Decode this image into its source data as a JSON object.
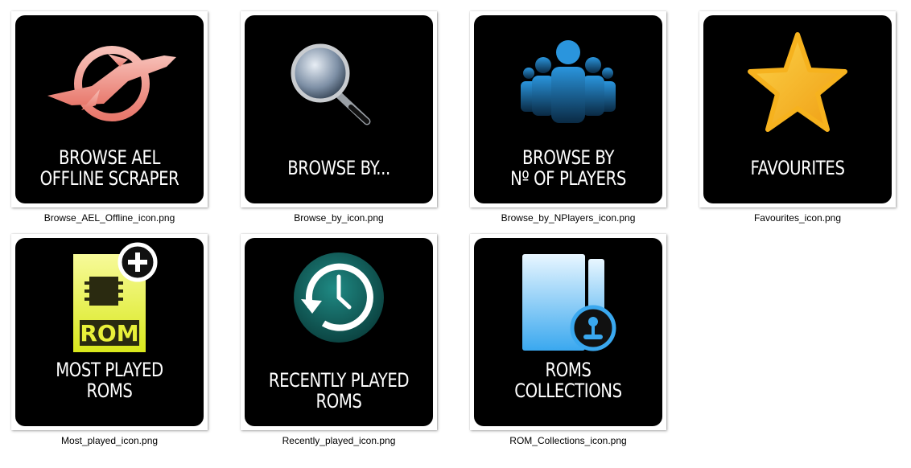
{
  "items": [
    {
      "label": "BROWSE AEL\nOFFLINE SCRAPER",
      "filename": "Browse_AEL_Offline_icon.png",
      "icon": "rocket-icon"
    },
    {
      "label": "BROWSE BY...",
      "filename": "Browse_by_icon.png",
      "icon": "magnifier-icon"
    },
    {
      "label": "BROWSE BY\nNº OF PLAYERS",
      "filename": "Browse_by_NPlayers_icon.png",
      "icon": "players-icon"
    },
    {
      "label": "FAVOURITES",
      "filename": "Favourites_icon.png",
      "icon": "star-icon"
    },
    {
      "label": "MOST PLAYED ROMS",
      "filename": "Most_played_icon.png",
      "icon": "rom-file-add-icon"
    },
    {
      "label": "RECENTLY PLAYED\nROMS",
      "filename": "Recently_played_icon.png",
      "icon": "history-clock-icon"
    },
    {
      "label": "ROMS COLLECTIONS",
      "filename": "ROM_Collections_icon.png",
      "icon": "folder-joystick-icon"
    }
  ],
  "colors": {
    "background": "#ffffff",
    "tile": "#000000",
    "rocket": "#f08a80",
    "star": "#f6b21e",
    "players": "#1a7fc4",
    "rom": "#e8f03a",
    "clock": "#0f6a66",
    "folder": "#5ab8f0"
  }
}
